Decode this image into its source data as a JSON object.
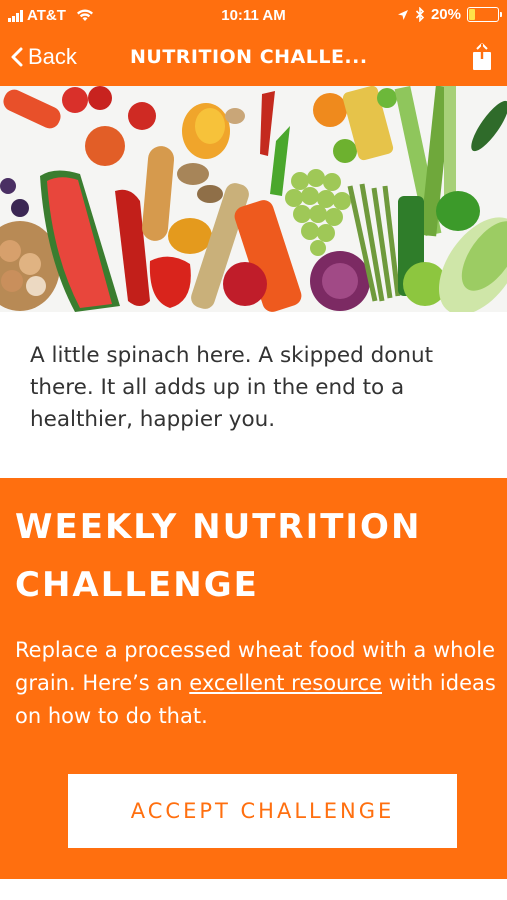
{
  "status_bar": {
    "carrier": "AT&T",
    "time": "10:11 AM",
    "battery_percent": "20%",
    "battery_level": 0.2,
    "icons": [
      "signal-icon",
      "wifi-icon",
      "location-arrow-icon",
      "bluetooth-icon",
      "battery-icon"
    ]
  },
  "nav": {
    "back_label": "Back",
    "title": "NUTRITION CHALLE...",
    "share_icon": "share-icon"
  },
  "hero": {
    "image": "produce-assortment-image"
  },
  "intro": {
    "text": "A little spinach here. A skipped donut there. It all adds up in the end to a healthier, happier you."
  },
  "challenge": {
    "title": "WEEKLY NUTRITION CHALLENGE",
    "desc_before": "Replace a processed wheat food with a whole grain. Here’s an ",
    "link_text": "excellent resource",
    "desc_after": " with ideas on how to do that.",
    "button_label": "ACCEPT CHALLENGE"
  },
  "colors": {
    "brand_orange": "#ff6f0f",
    "text_dark": "#333333",
    "white": "#ffffff"
  }
}
